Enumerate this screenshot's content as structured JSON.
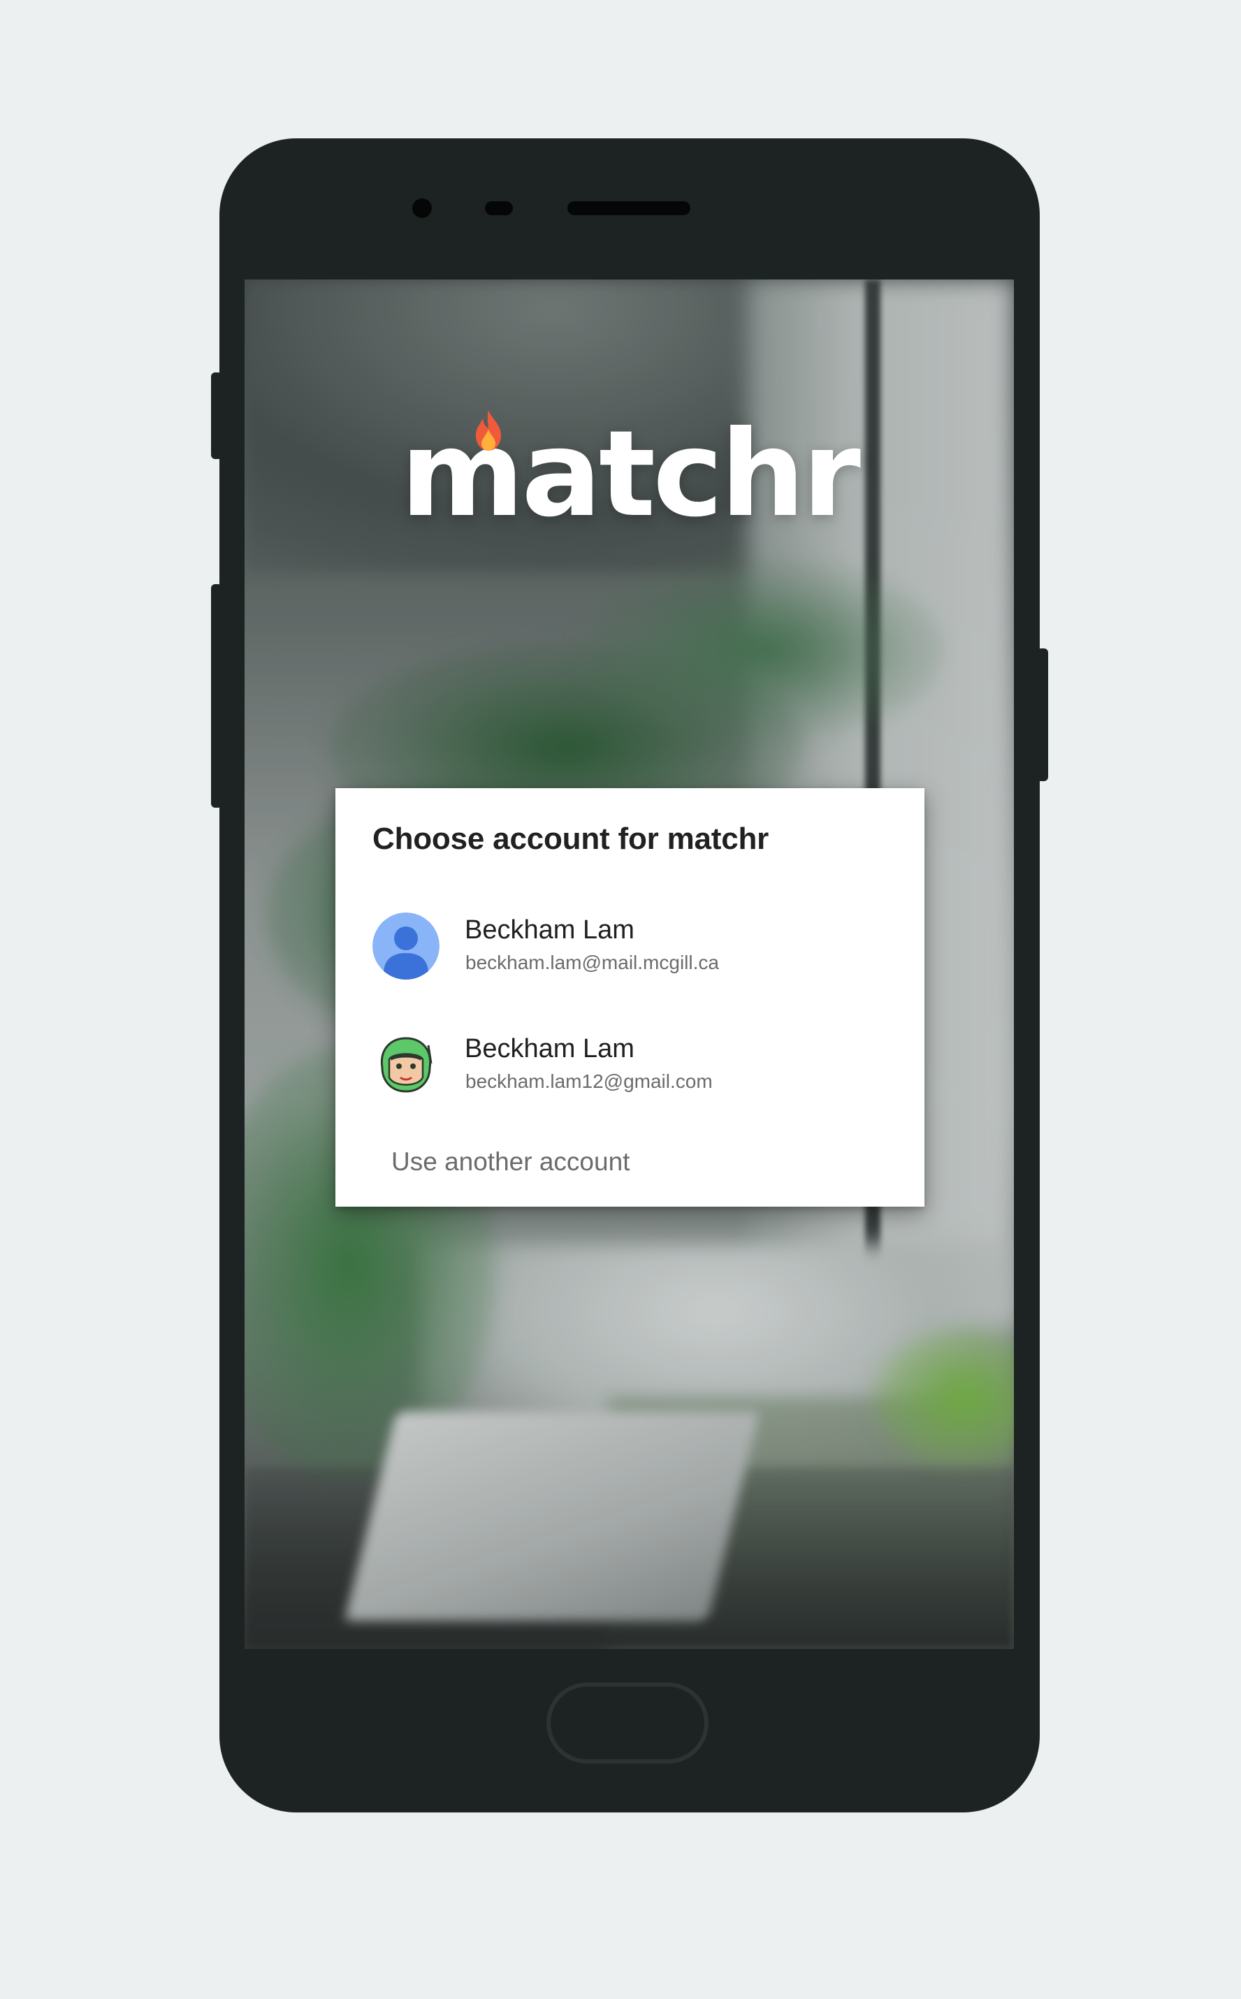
{
  "app": {
    "logo_text": "matchr"
  },
  "dialog": {
    "title": "Choose account for matchr",
    "accounts": [
      {
        "name": "Beckham Lam",
        "email": "beckham.lam@mail.mcgill.ca",
        "avatar": "default-person-icon"
      },
      {
        "name": "Beckham Lam",
        "email": "beckham.lam12@gmail.com",
        "avatar": "cartoon-face-avatar"
      }
    ],
    "use_another_label": "Use another account"
  },
  "colors": {
    "background": "#ecf0f1",
    "phone_body": "#1d2322",
    "dialog_bg": "#ffffff",
    "default_avatar_bg": "#8ab4f8",
    "default_avatar_fg": "#3b72d9",
    "flame": "#f05a3a"
  }
}
